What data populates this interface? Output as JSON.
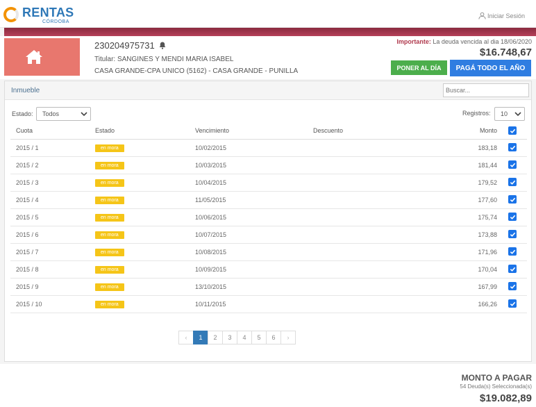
{
  "brand": {
    "name": "RENTAS",
    "sub": "CÓRDOBA"
  },
  "login_label": "Iniciar Sesión",
  "account": {
    "number": "230204975731",
    "titular": "Titular: SANGINES Y MENDI MARIA ISABEL",
    "address": "CASA GRANDE-CPA UNICO (5162) - CASA GRANDE - PUNILLA"
  },
  "debt": {
    "important_label": "Importante:",
    "important_text": "La deuda vencida al dia 18/06/2020",
    "amount": "$16.748,67"
  },
  "buttons": {
    "poner_al_dia": "PONER AL DÍA",
    "pagar_todo": "PAGÁ TODO EL AÑO"
  },
  "panel": {
    "title": "Inmueble",
    "search_placeholder": "Buscar...",
    "estado_label": "Estado:",
    "estado_value": "Todos",
    "registros_label": "Registros:",
    "registros_value": "10"
  },
  "table": {
    "headers": {
      "cuota": "Cuota",
      "estado": "Estado",
      "vencimiento": "Vencimiento",
      "descuento": "Descuento",
      "monto": "Monto"
    },
    "rows": [
      {
        "cuota": "2015 / 1",
        "estado": "en mora",
        "vencimiento": "10/02/2015",
        "descuento": "",
        "monto": "183,18"
      },
      {
        "cuota": "2015 / 2",
        "estado": "en mora",
        "vencimiento": "10/03/2015",
        "descuento": "",
        "monto": "181,44"
      },
      {
        "cuota": "2015 / 3",
        "estado": "en mora",
        "vencimiento": "10/04/2015",
        "descuento": "",
        "monto": "179,52"
      },
      {
        "cuota": "2015 / 4",
        "estado": "en mora",
        "vencimiento": "11/05/2015",
        "descuento": "",
        "monto": "177,60"
      },
      {
        "cuota": "2015 / 5",
        "estado": "en mora",
        "vencimiento": "10/06/2015",
        "descuento": "",
        "monto": "175,74"
      },
      {
        "cuota": "2015 / 6",
        "estado": "en mora",
        "vencimiento": "10/07/2015",
        "descuento": "",
        "monto": "173,88"
      },
      {
        "cuota": "2015 / 7",
        "estado": "en mora",
        "vencimiento": "10/08/2015",
        "descuento": "",
        "monto": "171,96"
      },
      {
        "cuota": "2015 / 8",
        "estado": "en mora",
        "vencimiento": "10/09/2015",
        "descuento": "",
        "monto": "170,04"
      },
      {
        "cuota": "2015 / 9",
        "estado": "en mora",
        "vencimiento": "13/10/2015",
        "descuento": "",
        "monto": "167,99"
      },
      {
        "cuota": "2015 / 10",
        "estado": "en mora",
        "vencimiento": "10/11/2015",
        "descuento": "",
        "monto": "166,26"
      }
    ]
  },
  "pagination": {
    "prev": "‹",
    "next": "›",
    "pages": [
      "1",
      "2",
      "3",
      "4",
      "5",
      "6"
    ],
    "active": "1"
  },
  "total": {
    "title": "MONTO A PAGAR",
    "subtitle": "54 Deuda(s) Seleccionada(s)",
    "amount": "$19.082,89"
  },
  "colors": {
    "accent_red": "#b54159",
    "house_box": "#e8776e",
    "green": "#4cae4c",
    "blue": "#2f7de1",
    "badge": "#f5c518"
  }
}
